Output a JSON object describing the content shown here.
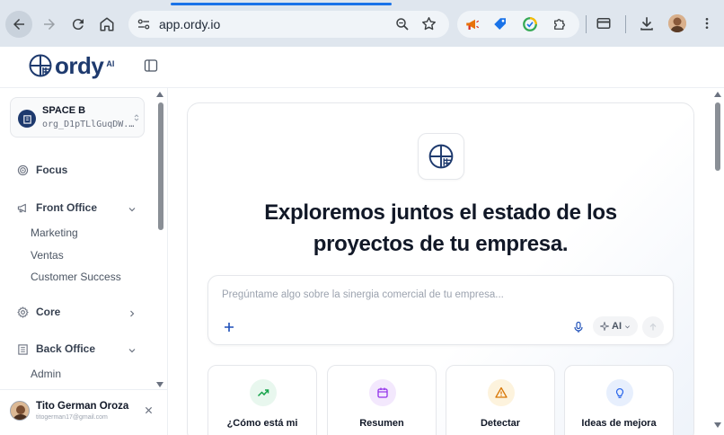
{
  "browser": {
    "url": "app.ordy.io",
    "icons": [
      "back-icon",
      "forward-icon",
      "reload-icon",
      "home-icon",
      "site-settings-icon",
      "zoom-icon",
      "bookmark-star-icon",
      "megaphone-extension-icon",
      "tag-extension-icon",
      "grammar-extension-icon",
      "extensions-puzzle-icon",
      "payment-card-icon",
      "download-icon",
      "kebab-menu-icon"
    ]
  },
  "app": {
    "logo_text": "ordy",
    "logo_suffix": "AI"
  },
  "sidebar": {
    "space": {
      "name": "SPACE B",
      "org": "org_D1pTLlGuqDW..."
    },
    "items": [
      {
        "label": "Focus",
        "icon": "target-icon",
        "expandable": false
      },
      {
        "label": "Front Office",
        "icon": "megaphone-icon",
        "expandable": true,
        "expanded": true,
        "children": [
          "Marketing",
          "Ventas",
          "Customer Success"
        ]
      },
      {
        "label": "Core",
        "icon": "gear-icon",
        "expandable": true,
        "expanded": false
      },
      {
        "label": "Back Office",
        "icon": "building-icon",
        "expandable": true,
        "expanded": true,
        "children": [
          "Admin"
        ]
      }
    ],
    "user": {
      "name": "Tito German Oroza",
      "email": "titogerman17@gmail.com"
    }
  },
  "main": {
    "title_line1": "Exploremos juntos el estado de los",
    "title_line2": "proyectos de tu empresa.",
    "prompt": {
      "placeholder": "Pregúntame algo sobre la sinergia comercial de tu empresa...",
      "value": "",
      "model_label": "AI"
    },
    "cards": [
      {
        "label": "¿Cómo está mi",
        "icon": "trend-up-icon",
        "color": "#16a34a",
        "bg": "#e8f7ee"
      },
      {
        "label": "Resumen",
        "icon": "calendar-icon",
        "color": "#9333ea",
        "bg": "#f3e8fd"
      },
      {
        "label": "Detectar",
        "icon": "warning-icon",
        "color": "#d97706",
        "bg": "#fdf3dd"
      },
      {
        "label": "Ideas de mejora",
        "icon": "lightbulb-icon",
        "color": "#2563eb",
        "bg": "#e7effd"
      }
    ]
  },
  "colors": {
    "brand": "#1e3a6e",
    "chrome_bg": "#dfe6ee",
    "accent_blue": "#1a73e8"
  }
}
